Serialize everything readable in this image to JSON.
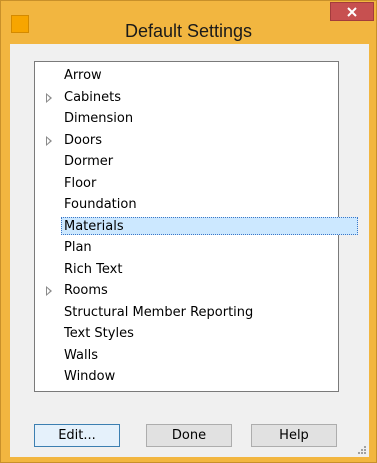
{
  "window": {
    "title": "Default Settings"
  },
  "list": {
    "items": [
      {
        "label": "Arrow",
        "expandable": false,
        "selected": false
      },
      {
        "label": "Cabinets",
        "expandable": true,
        "selected": false
      },
      {
        "label": "Dimension",
        "expandable": false,
        "selected": false
      },
      {
        "label": "Doors",
        "expandable": true,
        "selected": false
      },
      {
        "label": "Dormer",
        "expandable": false,
        "selected": false
      },
      {
        "label": "Floor",
        "expandable": false,
        "selected": false
      },
      {
        "label": "Foundation",
        "expandable": false,
        "selected": false
      },
      {
        "label": "Materials",
        "expandable": false,
        "selected": true
      },
      {
        "label": "Plan",
        "expandable": false,
        "selected": false
      },
      {
        "label": "Rich Text",
        "expandable": false,
        "selected": false
      },
      {
        "label": "Rooms",
        "expandable": true,
        "selected": false
      },
      {
        "label": "Structural Member Reporting",
        "expandable": false,
        "selected": false
      },
      {
        "label": "Text Styles",
        "expandable": false,
        "selected": false
      },
      {
        "label": "Walls",
        "expandable": false,
        "selected": false
      },
      {
        "label": "Window",
        "expandable": false,
        "selected": false
      }
    ]
  },
  "buttons": {
    "edit": "Edit...",
    "done": "Done",
    "help": "Help"
  },
  "colors": {
    "frame": "#f2b640",
    "close": "#c75050",
    "selection": "#cce8ff"
  },
  "icons": {
    "app": "app-icon",
    "close": "close-icon",
    "expand": "expand-arrow-icon",
    "grip": "resize-grip-icon"
  }
}
